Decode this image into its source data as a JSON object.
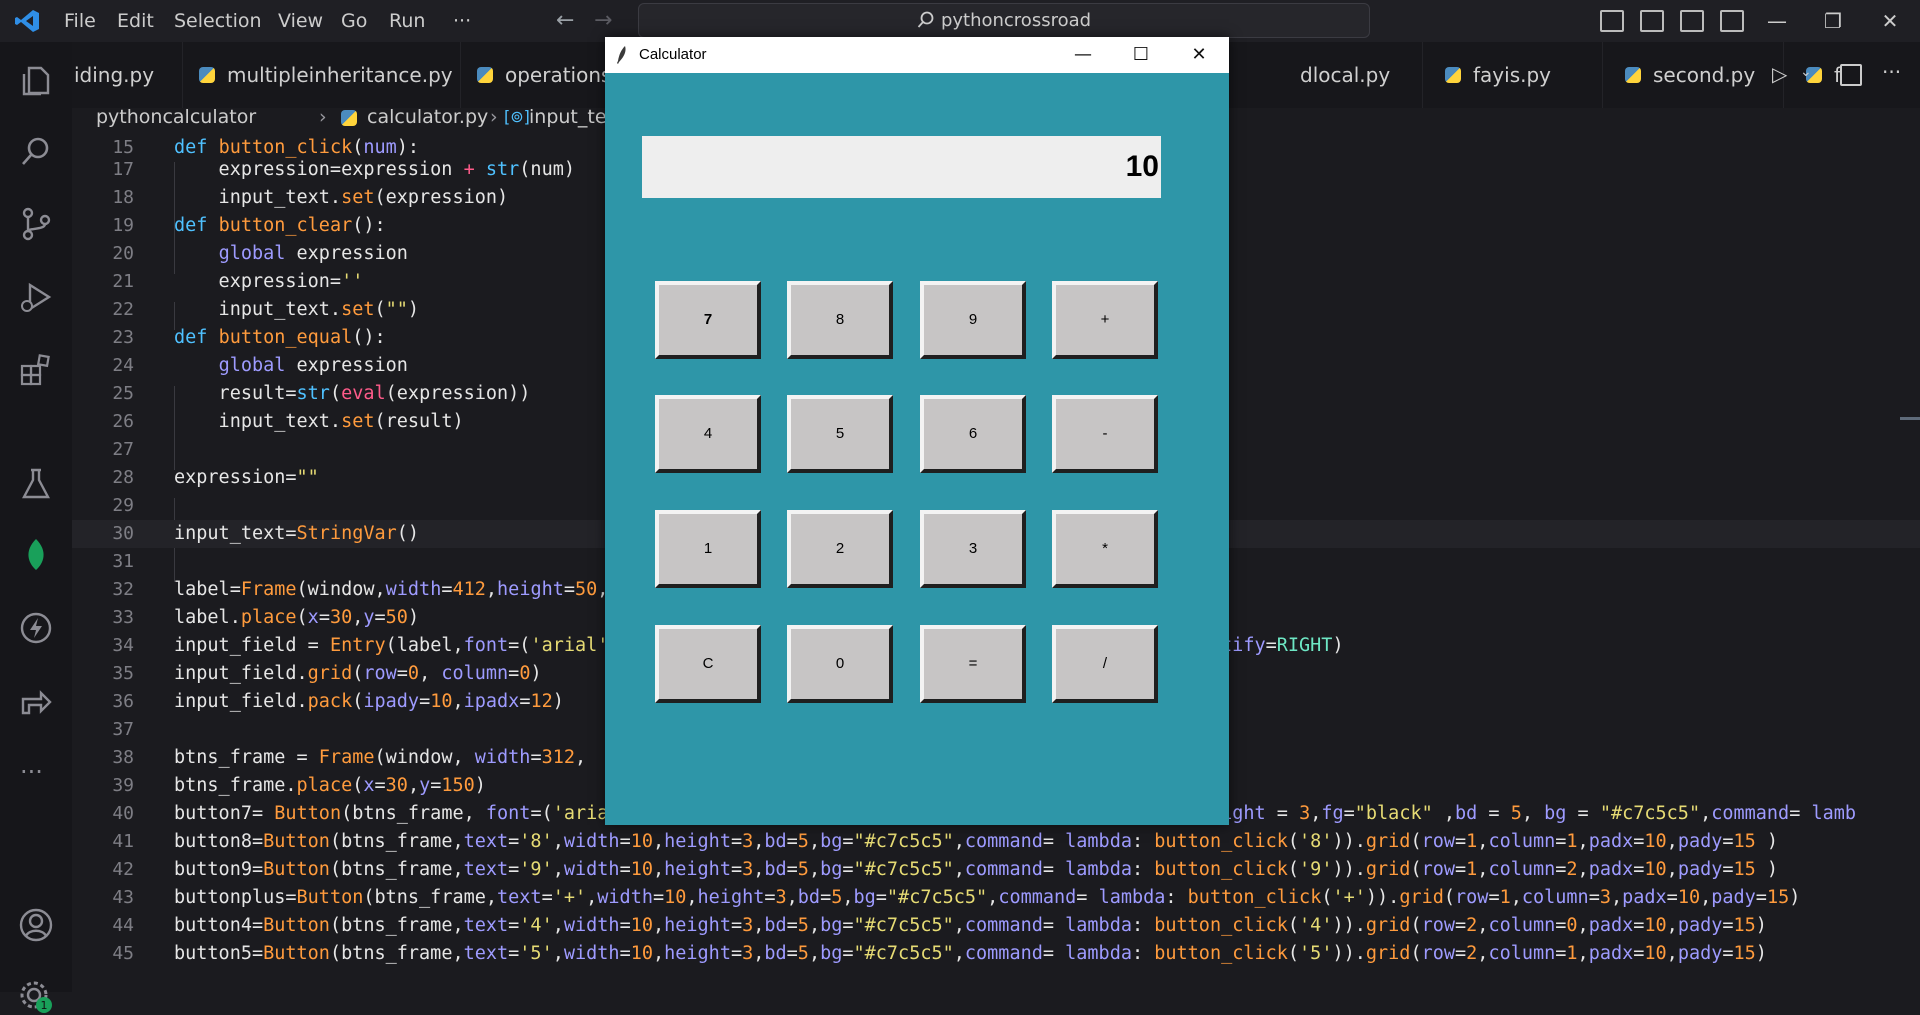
{
  "titlebar": {
    "menus": [
      "File",
      "Edit",
      "Selection",
      "View",
      "Go",
      "Run",
      "···"
    ],
    "search_text": "pythoncrossroad",
    "window_controls": [
      "minimize",
      "restore",
      "close"
    ]
  },
  "tabs": [
    {
      "label": "iding.py"
    },
    {
      "label": "multipleinheritance.py"
    },
    {
      "label": "operations"
    },
    {
      "label": "dlocal.py"
    },
    {
      "label": "fayis.py"
    },
    {
      "label": "second.py"
    },
    {
      "label": "f"
    }
  ],
  "breadcrumb": {
    "folder": "pythoncalculator",
    "file": "calculator.py",
    "symbol": "input_text"
  },
  "editor": {
    "line_numbers": [
      "15",
      "17",
      "18",
      "19",
      "20",
      "21",
      "22",
      "23",
      "24",
      "25",
      "26",
      "27",
      "28",
      "29",
      "30",
      "31",
      "32",
      "33",
      "34",
      "35",
      "36",
      "37",
      "38",
      "39",
      "40",
      "41",
      "42",
      "43",
      "44",
      "45"
    ]
  },
  "calculator": {
    "title": "Calculator",
    "display_value": "10",
    "buttons": [
      "7",
      "8",
      "9",
      "+",
      "4",
      "5",
      "6",
      "-",
      "1",
      "2",
      "3",
      "*",
      "C",
      "0",
      "=",
      "/"
    ],
    "button_color": "#c7c5c5",
    "background_color": "#2e96a8"
  }
}
